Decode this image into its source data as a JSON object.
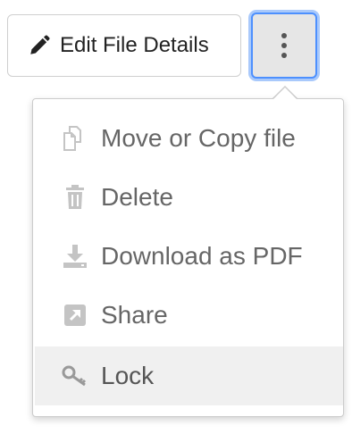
{
  "toolbar": {
    "edit_label": "Edit File Details",
    "edit_icon": "pencil-icon",
    "more_icon": "vertical-ellipsis-icon"
  },
  "menu": {
    "items": [
      {
        "label": "Move or Copy file",
        "icon": "copy-icon"
      },
      {
        "label": "Delete",
        "icon": "trash-icon"
      },
      {
        "label": "Download as PDF",
        "icon": "download-icon"
      },
      {
        "label": "Share",
        "icon": "share-icon"
      },
      {
        "label": "Lock",
        "icon": "key-icon",
        "highlighted": true
      }
    ]
  },
  "colors": {
    "focus_ring": "#4d90fe",
    "icon_gray": "#c4c4c4",
    "text_gray": "#666666",
    "highlight_bg": "#f0f0f0"
  }
}
